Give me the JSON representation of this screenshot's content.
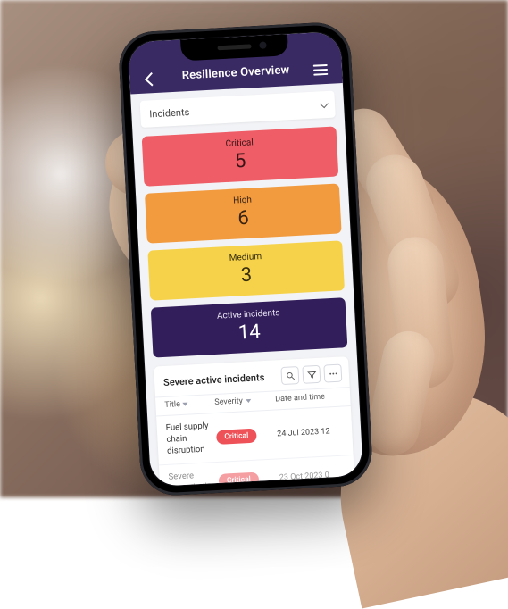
{
  "header": {
    "title": "Resilience Overview"
  },
  "dropdown": {
    "selected": "Incidents"
  },
  "cards": {
    "critical": {
      "label": "Critical",
      "value": "5",
      "color": "#ef5d66"
    },
    "high": {
      "label": "High",
      "value": "6",
      "color": "#f19a3e"
    },
    "medium": {
      "label": "Medium",
      "value": "3",
      "color": "#f6d24a"
    },
    "active": {
      "label": "Active incidents",
      "value": "14",
      "color": "#321e5a"
    }
  },
  "list": {
    "title": "Severe active incidents",
    "columns": {
      "title": "Title",
      "severity": "Severity",
      "datetime": "Date and time"
    },
    "rows": [
      {
        "title": "Fuel supply chain disruption",
        "severity": "Critical",
        "datetime": "24 Jul 2023 12"
      },
      {
        "title": "Severe storm in the",
        "severity": "Critical",
        "datetime": "23 Oct 2023 0"
      }
    ]
  }
}
